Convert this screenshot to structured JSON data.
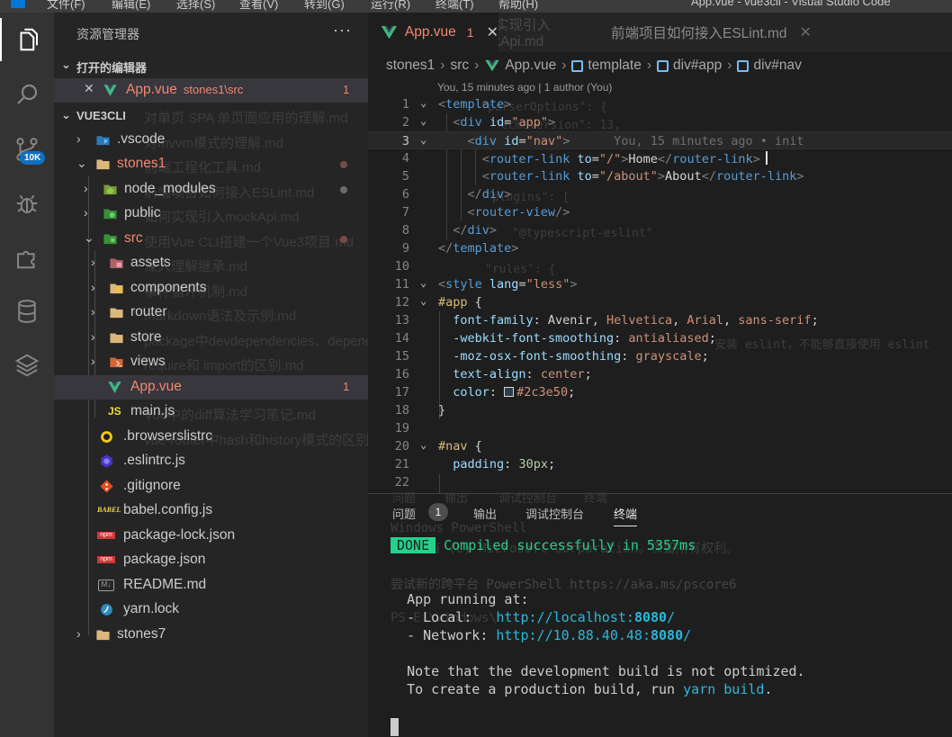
{
  "menubar": {
    "items": [
      "文件(F)",
      "编辑(E)",
      "选择(S)",
      "查看(V)",
      "转到(G)",
      "运行(R)",
      "终端(T)",
      "帮助(H)"
    ],
    "window_title": "App.vue - vue3cli - Visual Studio Code"
  },
  "activity": {
    "items": [
      "explorer-icon",
      "search-icon",
      "source-control-icon",
      "debug-icon",
      "extensions-icon",
      "database-icon",
      "layers-icon"
    ],
    "scm_badge": "10K"
  },
  "sidebar": {
    "title": "资源管理器",
    "more": "···",
    "open_editors": {
      "label": "打开的编辑器",
      "items": [
        {
          "name": "App.vue",
          "path": "stones1\\src",
          "count": "1"
        }
      ]
    },
    "workspace": {
      "label": "VUE3CLI",
      "items": [
        {
          "name": ".vscode",
          "icon": "vscode-folder-icon"
        },
        {
          "name": "stones1",
          "icon": "folder-icon"
        },
        {
          "name": "node_modules",
          "icon": "node-folder-icon"
        },
        {
          "name": "public",
          "icon": "public-folder-icon"
        },
        {
          "name": "src",
          "icon": "src-folder-icon"
        },
        {
          "name": "assets",
          "icon": "assets-folder-icon"
        },
        {
          "name": "components",
          "icon": "components-folder-icon"
        },
        {
          "name": "router",
          "icon": "folder-icon"
        },
        {
          "name": "store",
          "icon": "folder-icon"
        },
        {
          "name": "views",
          "icon": "views-folder-icon"
        },
        {
          "name": "App.vue",
          "icon": "vue-file-icon",
          "count": "1"
        },
        {
          "name": "main.js",
          "icon": "js-file-icon"
        },
        {
          "name": ".browserslistrc",
          "icon": "browserslist-icon"
        },
        {
          "name": ".eslintrc.js",
          "icon": "eslint-icon"
        },
        {
          "name": ".gitignore",
          "icon": "git-icon"
        },
        {
          "name": "babel.config.js",
          "icon": "babel-icon"
        },
        {
          "name": "package-lock.json",
          "icon": "npm-icon"
        },
        {
          "name": "package.json",
          "icon": "npm-icon"
        },
        {
          "name": "README.md",
          "icon": "markdown-icon"
        },
        {
          "name": "yarn.lock",
          "icon": "yarn-icon"
        },
        {
          "name": "stones7",
          "icon": "folder-icon"
        }
      ]
    },
    "ghost_text": [
      "对单页 SPA 单页面应用的理解.md",
      "对mvvm模式的理解.md",
      "前端工程化工具.md",
      "前端项目如何接入ESLint.md",
      "如何实现引入mockApi.md",
      "使用Vue CLI搭建一个Vue3项目.md",
      "深入理解继承.md",
      "事件循环机制.md",
      "markdown语法及示例.md",
      "package中devdependencies、dependencies的区别",
      "require和 import的区别.md",
      "Vue双向绑定原理.md",
      "Vue中的diff算法学习笔记.md",
      "vue-router中hash和history模式的区别.md"
    ]
  },
  "editor": {
    "tabs": [
      {
        "name": "App.vue",
        "count": "1",
        "close": "✕"
      },
      {
        "name": "如何实现引入mockApi.md"
      },
      {
        "name": "前端项目如何接入ESLint.md",
        "close": "✕"
      }
    ],
    "breadcrumb": [
      "stones1",
      "src",
      "App.vue",
      "template",
      "div#app",
      "div#nav"
    ],
    "codelens": "You, 15 minutes ago | 1 author (You)",
    "blame": "You, 15 minutes ago • init",
    "ghost_lines": [
      "\"parserOptions\": {",
      "\"ecmaVersion\": 13,",
      "\"sourceType\": \"module\"",
      "\"plugins\": [",
      "\"@typescript-eslint\"",
      "\"rules\": {",
      "安装 eslint，不能够直接使用 eslint"
    ],
    "lines": [
      {
        "n": "1"
      },
      {
        "n": "2"
      },
      {
        "n": "3"
      },
      {
        "n": "4"
      },
      {
        "n": "5"
      },
      {
        "n": "6"
      },
      {
        "n": "7"
      },
      {
        "n": "8"
      },
      {
        "n": "9"
      },
      {
        "n": "10"
      },
      {
        "n": "11"
      },
      {
        "n": "12"
      },
      {
        "n": "13"
      },
      {
        "n": "14"
      },
      {
        "n": "15"
      },
      {
        "n": "16"
      },
      {
        "n": "17"
      },
      {
        "n": "18"
      },
      {
        "n": "19"
      },
      {
        "n": "20"
      },
      {
        "n": "21"
      },
      {
        "n": "22"
      }
    ]
  },
  "panel": {
    "tabs": [
      "问题",
      "输出",
      "调试控制台",
      "终端"
    ],
    "problems_count": "1",
    "ghost_tabs": [
      "问题",
      "输出",
      "调试控制台",
      "终端"
    ],
    "terminal": {
      "done_badge": "DONE",
      "compiled": "Compiled successfully in 5357ms",
      "running": "App running at:",
      "local_label": "- Local:   ",
      "local_url": "http://localhost:",
      "local_port": "8080",
      "network_label": "- Network: ",
      "network_url": "http://10.88.40.48:",
      "network_port": "8080",
      "note1": "Note that the development build is not optimized.",
      "note2_pre": "To create a production build, run ",
      "note2_cmd": "yarn build",
      "note2_post": ".",
      "ghost_lines": [
        "Windows PowerShell",
        "版权所有 (C) Microsoft Corporation。保留所有权利。",
        "尝试新的跨平台 PowerShell https://aka.ms/pscore6",
        "PS E:\\windows\\"
      ]
    }
  },
  "colors": {
    "accent": "#0e70c0",
    "error": "#f48771",
    "terminal_green": "#23d18b",
    "terminal_cyan": "#29b8db",
    "css_color_value": "#2c3e50"
  }
}
